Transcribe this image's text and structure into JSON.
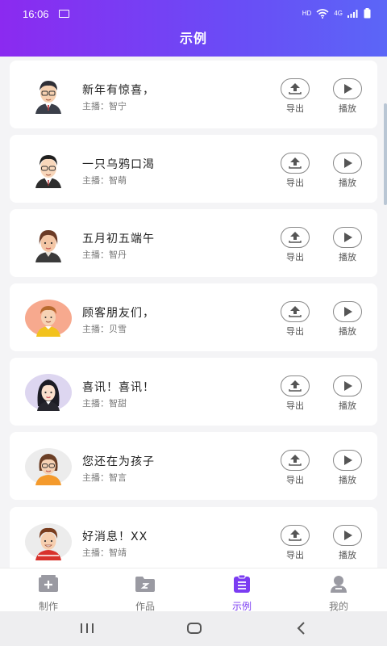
{
  "status_bar": {
    "time": "16:06",
    "network_hd": "HD",
    "network_4g": "4G"
  },
  "header": {
    "title": "示例"
  },
  "items": [
    {
      "title": "新年有惊喜，",
      "host": "主播：智宁",
      "avatar": "man-glasses-suit-icon",
      "avatar_bg": "#ffffff"
    },
    {
      "title": "一只乌鸦口渴",
      "host": "主播：智萌",
      "avatar": "man-glasses-shirt-icon",
      "avatar_bg": "#ffffff"
    },
    {
      "title": "五月初五端午",
      "host": "主播：智丹",
      "avatar": "woman-short-hair-icon",
      "avatar_bg": "#ffffff"
    },
    {
      "title": "顾客朋友们，",
      "host": "主播：贝雪",
      "avatar": "man-yellow-shirt-icon",
      "avatar_bg": "#f7a98e"
    },
    {
      "title": "喜讯！喜讯！",
      "host": "主播：智甜",
      "avatar": "woman-long-hair-icon",
      "avatar_bg": "#ddd6f0"
    },
    {
      "title": "您还在为孩子",
      "host": "主播：智言",
      "avatar": "woman-orange-shirt-icon",
      "avatar_bg": "#ececec"
    },
    {
      "title": "好消息！XX",
      "host": "主播：智靖",
      "avatar": "man-red-shirt-icon",
      "avatar_bg": "#ececec"
    }
  ],
  "actions": {
    "export_label": "导出",
    "play_label": "播放"
  },
  "tabs": [
    {
      "label": "制作",
      "icon": "add-box-icon",
      "active": false
    },
    {
      "label": "作品",
      "icon": "folder-icon",
      "active": false
    },
    {
      "label": "示例",
      "icon": "clipboard-list-icon",
      "active": true
    },
    {
      "label": "我的",
      "icon": "person-icon",
      "active": false
    }
  ],
  "colors": {
    "accent": "#7b3cf2",
    "header_gradient_start": "#8b2af0",
    "header_gradient_end": "#5b66f7"
  }
}
